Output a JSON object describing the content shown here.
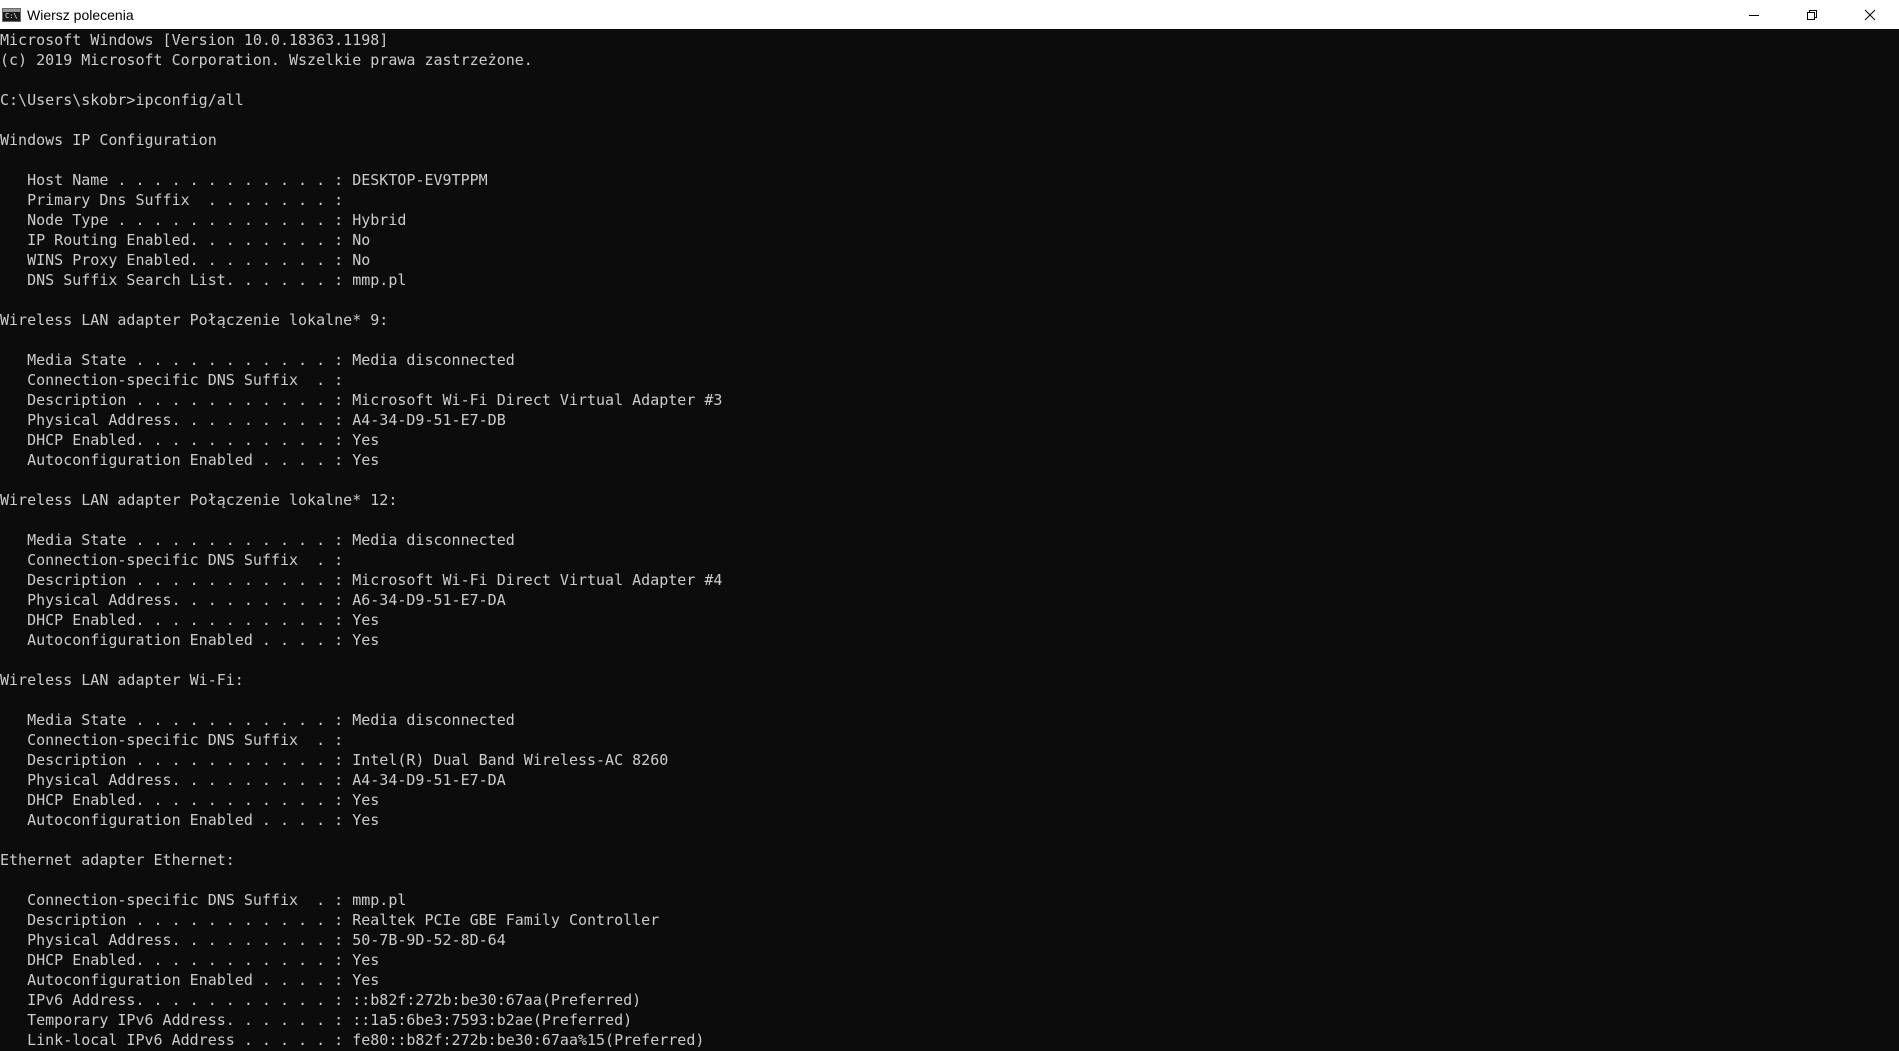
{
  "window": {
    "title": "Wiersz polecenia",
    "icon": "cmd-icon",
    "controls": [
      "minimize-icon",
      "restore-icon",
      "close-icon"
    ]
  },
  "console": {
    "lines": [
      "Microsoft Windows [Version 10.0.18363.1198]",
      "(c) 2019 Microsoft Corporation. Wszelkie prawa zastrzeżone.",
      "",
      "C:\\Users\\skobr>ipconfig/all",
      "",
      "Windows IP Configuration",
      "",
      "   Host Name . . . . . . . . . . . . : DESKTOP-EV9TPPM",
      "   Primary Dns Suffix  . . . . . . . :",
      "   Node Type . . . . . . . . . . . . : Hybrid",
      "   IP Routing Enabled. . . . . . . . : No",
      "   WINS Proxy Enabled. . . . . . . . : No",
      "   DNS Suffix Search List. . . . . . : mmp.pl",
      "",
      "Wireless LAN adapter Połączenie lokalne* 9:",
      "",
      "   Media State . . . . . . . . . . . : Media disconnected",
      "   Connection-specific DNS Suffix  . :",
      "   Description . . . . . . . . . . . : Microsoft Wi-Fi Direct Virtual Adapter #3",
      "   Physical Address. . . . . . . . . : A4-34-D9-51-E7-DB",
      "   DHCP Enabled. . . . . . . . . . . : Yes",
      "   Autoconfiguration Enabled . . . . : Yes",
      "",
      "Wireless LAN adapter Połączenie lokalne* 12:",
      "",
      "   Media State . . . . . . . . . . . : Media disconnected",
      "   Connection-specific DNS Suffix  . :",
      "   Description . . . . . . . . . . . : Microsoft Wi-Fi Direct Virtual Adapter #4",
      "   Physical Address. . . . . . . . . : A6-34-D9-51-E7-DA",
      "   DHCP Enabled. . . . . . . . . . . : Yes",
      "   Autoconfiguration Enabled . . . . : Yes",
      "",
      "Wireless LAN adapter Wi-Fi:",
      "",
      "   Media State . . . . . . . . . . . : Media disconnected",
      "   Connection-specific DNS Suffix  . :",
      "   Description . . . . . . . . . . . : Intel(R) Dual Band Wireless-AC 8260",
      "   Physical Address. . . . . . . . . : A4-34-D9-51-E7-DA",
      "   DHCP Enabled. . . . . . . . . . . : Yes",
      "   Autoconfiguration Enabled . . . . : Yes",
      "",
      "Ethernet adapter Ethernet:",
      "",
      "   Connection-specific DNS Suffix  . : mmp.pl",
      "   Description . . . . . . . . . . . : Realtek PCIe GBE Family Controller",
      "   Physical Address. . . . . . . . . : 50-7B-9D-52-8D-64",
      "   DHCP Enabled. . . . . . . . . . . : Yes",
      "   Autoconfiguration Enabled . . . . : Yes",
      "   IPv6 Address. . . . . . . . . . . : ::b82f:272b:be30:67aa(Preferred)",
      "   Temporary IPv6 Address. . . . . . : ::1a5:6be3:7593:b2ae(Preferred)",
      "   Link-local IPv6 Address . . . . . : fe80::b82f:272b:be30:67aa%15(Preferred)"
    ]
  }
}
